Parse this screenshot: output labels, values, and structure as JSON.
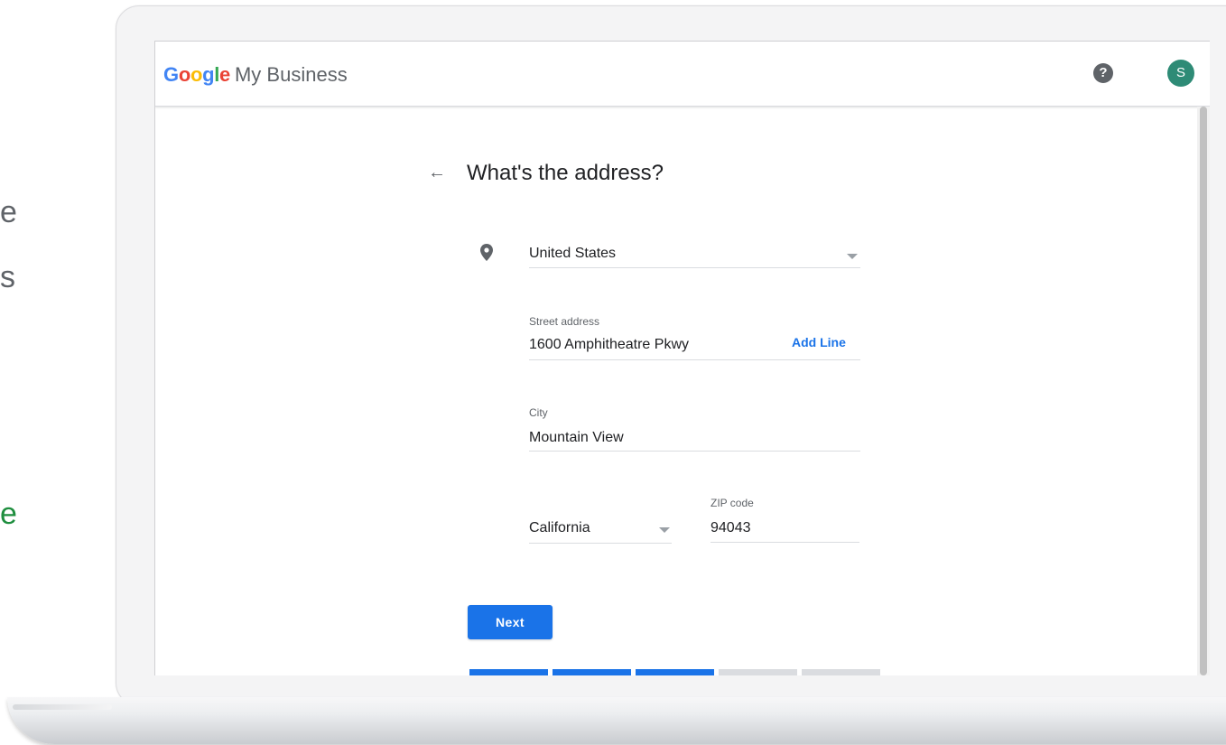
{
  "left_text": {
    "frag1": "e",
    "frag2": "s",
    "frag3": "e"
  },
  "header": {
    "brand_google": [
      "G",
      "o",
      "o",
      "g",
      "l",
      "e"
    ],
    "brand_product": "My Business",
    "help_icon": "help-circle-icon",
    "avatar_initial": "S"
  },
  "form": {
    "title": "What's the address?",
    "back_icon": "arrow-left-icon",
    "location_icon": "location-pin-icon",
    "country": {
      "value": "United States"
    },
    "street": {
      "label": "Street address",
      "value": "1600 Amphitheatre Pkwy",
      "add_line": "Add Line"
    },
    "city": {
      "label": "City",
      "value": "Mountain View"
    },
    "state": {
      "value": "California"
    },
    "zip": {
      "label": "ZIP code",
      "value": "94043"
    },
    "next_label": "Next"
  },
  "progress": {
    "total_steps": 5,
    "completed_steps": 3
  },
  "colors": {
    "accent": "#1a73e8",
    "avatar_bg": "#2e8b76",
    "google_blue": "#4285f4",
    "google_red": "#ea4335",
    "google_yellow": "#fbbc05",
    "google_green": "#34a853"
  }
}
